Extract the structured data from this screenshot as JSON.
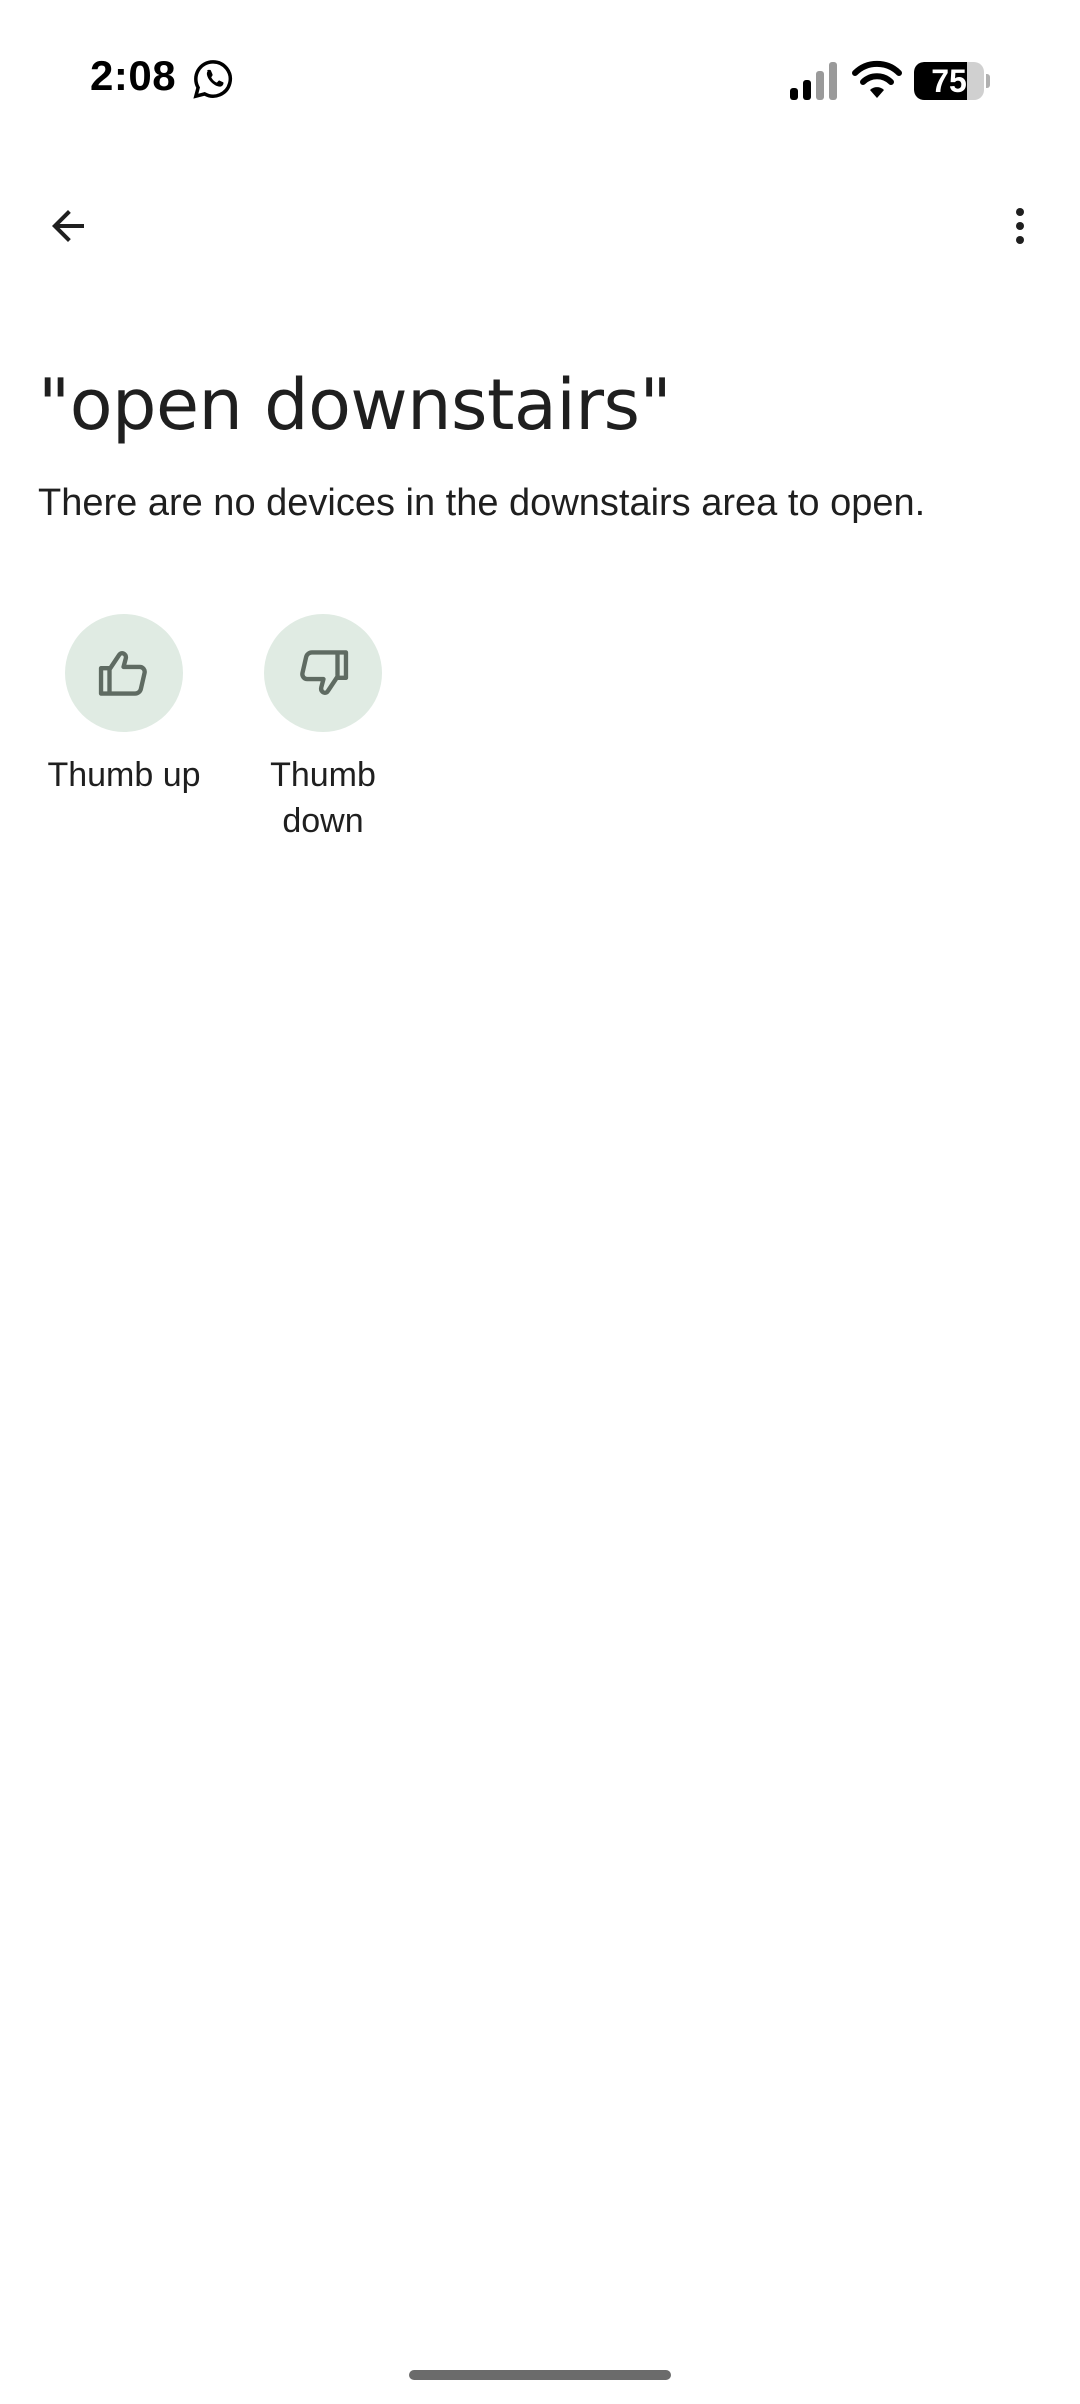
{
  "status_bar": {
    "time": "2:08",
    "battery_level": "75",
    "battery_fraction": 0.75
  },
  "app_bar": {
    "back_icon": "arrow-back-icon",
    "more_icon": "more-vert-icon"
  },
  "content": {
    "query": "\"open downstairs\"",
    "response": "There are no devices in the downstairs area to open."
  },
  "feedback": {
    "thumb_up_label": "Thumb up",
    "thumb_down_label": "Thumb\ndown",
    "icon_color": "#5f6b62",
    "circle_color": "#e0ebe3"
  }
}
